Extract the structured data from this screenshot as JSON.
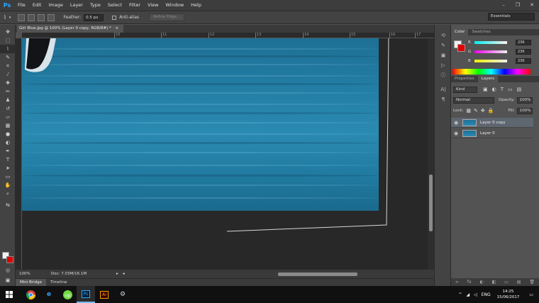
{
  "app": {
    "logo": "Ps"
  },
  "menu": [
    "File",
    "Edit",
    "Image",
    "Layer",
    "Type",
    "Select",
    "Filter",
    "View",
    "Window",
    "Help"
  ],
  "window_controls": {
    "minimize": "–",
    "restore": "❐",
    "close": "✕"
  },
  "options_bar": {
    "feather_label": "Feather:",
    "feather_value": "0.5 px",
    "antialias_label": "Anti-alias",
    "refine_edge": "Refine Edge...",
    "workspace": "Essentials"
  },
  "document": {
    "tab_title": "Girl Blue.jpg @ 100% (Layer 0 copy, RGB/8#) *",
    "close": "×"
  },
  "rulers": {
    "h_ticks": [
      "10",
      "11",
      "12",
      "13",
      "14",
      "15",
      "16",
      "17"
    ]
  },
  "status": {
    "zoom": "100%",
    "doc_info": "Doc: 7.03M/16.1M"
  },
  "bottom_tabs": [
    "Mini Bridge",
    "Timeline"
  ],
  "color_panel": {
    "tabs": [
      "Color",
      "Swatches"
    ],
    "channels": [
      {
        "label": "R",
        "value": "236",
        "color": "#ff7070"
      },
      {
        "label": "G",
        "value": "236",
        "color": "#ff60ff"
      },
      {
        "label": "B",
        "value": "236",
        "color": "#f0f070"
      }
    ]
  },
  "layers_panel": {
    "tabs": [
      "Properties",
      "Layers"
    ],
    "filter_kind": "Kind",
    "blend_mode": "Normal",
    "opacity_label": "Opacity:",
    "opacity_value": "100%",
    "lock_label": "Lock:",
    "fill_label": "Fill:",
    "fill_value": "100%",
    "layers": [
      {
        "name": "Layer 0 copy",
        "selected": true
      },
      {
        "name": "Layer 0",
        "selected": false
      }
    ],
    "footer_icons": [
      "∞",
      "fx",
      "◐",
      "◧",
      "▭",
      "▤",
      "🗑"
    ]
  },
  "taskbar": {
    "apps": [
      "Chrome",
      "Edge",
      "Upwork",
      "Ps",
      "Ai",
      "Steam"
    ],
    "language": "ENG",
    "time": "14:25",
    "date": "15/06/2017"
  }
}
